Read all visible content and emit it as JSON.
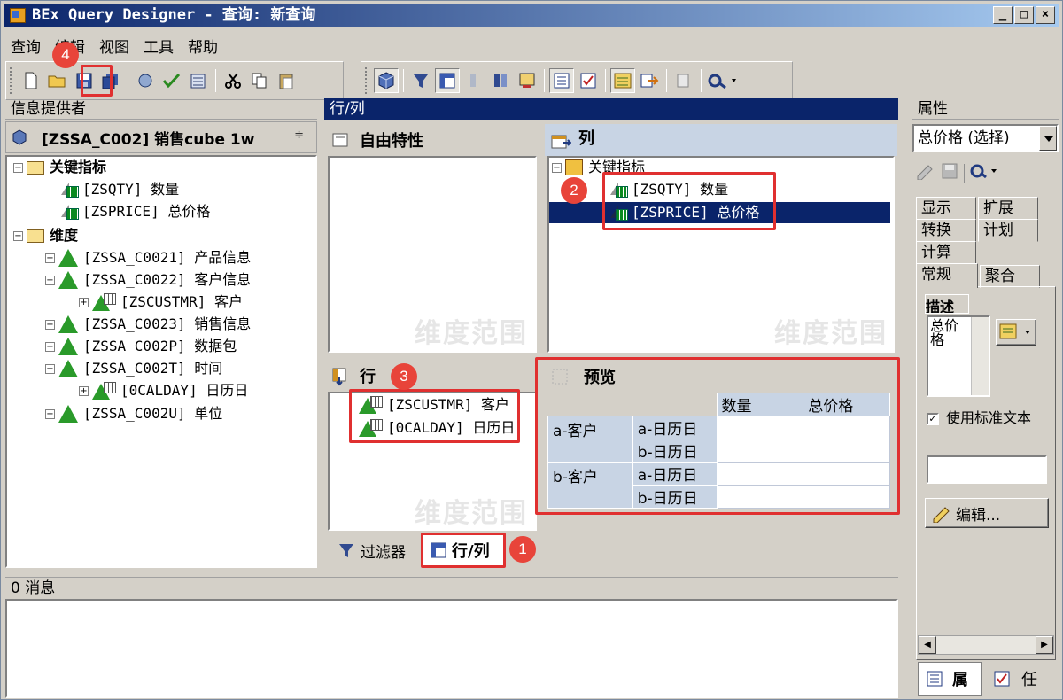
{
  "window": {
    "title": "BEx Query Designer - 查询: 新查询",
    "min": "_",
    "max": "□",
    "close": "×"
  },
  "menu": [
    "查询",
    "编辑",
    "视图",
    "工具",
    "帮助"
  ],
  "toolbar": {
    "icons": [
      "new-icon",
      "open-icon",
      "save-icon",
      "save-all-icon",
      "publish-icon",
      "check-icon",
      "properties-icon",
      "cut-icon",
      "copy-icon",
      "paste-icon",
      "cube-icon",
      "filter-icon",
      "rows-columns-icon",
      "cells-icon",
      "conditions-icon",
      "exceptions-icon",
      "table-view-icon",
      "tasks-icon",
      "key-figures-icon",
      "export-icon",
      "doc-icon",
      "tools-icon"
    ]
  },
  "info_provider": {
    "title": "信息提供者",
    "provider_name": "[ZSSA_C002] 销售cube 1w",
    "tree": [
      {
        "label": "关键指标",
        "type": "folder",
        "expanded": true
      },
      {
        "label": "[ZSQTY] 数量",
        "type": "keyfigure"
      },
      {
        "label": "[ZSPRICE] 总价格",
        "type": "keyfigure"
      },
      {
        "label": "维度",
        "type": "folder",
        "expanded": true
      },
      {
        "label": "[ZSSA_C0021] 产品信息",
        "type": "dimension",
        "collapsed": true
      },
      {
        "label": "[ZSSA_C0022] 客户信息",
        "type": "dimension",
        "expanded": true
      },
      {
        "label": "[ZSCUSTMR] 客户",
        "type": "characteristic"
      },
      {
        "label": "[ZSSA_C0023] 销售信息",
        "type": "dimension",
        "collapsed": true
      },
      {
        "label": "[ZSSA_C002P] 数据包",
        "type": "dimension",
        "collapsed": true
      },
      {
        "label": "[ZSSA_C002T] 时间",
        "type": "dimension",
        "expanded": true
      },
      {
        "label": "[0CALDAY] 日历日",
        "type": "characteristic"
      },
      {
        "label": "[ZSSA_C002U] 单位",
        "type": "dimension",
        "collapsed": true
      }
    ]
  },
  "rows_cols": {
    "title": "行/列",
    "free_chars": {
      "title": "自由特性"
    },
    "columns": {
      "title": "列",
      "root": "关键指标",
      "items": [
        "[ZSQTY] 数量",
        "[ZSPRICE] 总价格"
      ]
    },
    "rows": {
      "title": "行",
      "items": [
        "[ZSCUSTMR] 客户",
        "[0CALDAY] 日历日"
      ]
    },
    "watermark": "维度范围",
    "preview": {
      "title": "预览",
      "headers": [
        "数量",
        "总价格"
      ],
      "groups": [
        {
          "customer": "a-客户",
          "days": [
            "a-日历日",
            "b-日历日"
          ]
        },
        {
          "customer": "b-客户",
          "days": [
            "a-日历日",
            "b-日历日"
          ]
        }
      ]
    },
    "tabs": [
      "过滤器",
      "行/列"
    ]
  },
  "messages": {
    "title": "0 消息"
  },
  "properties": {
    "title": "属性",
    "selected": "总价格 (选择)",
    "tabs_row1": [
      "显示",
      "扩展"
    ],
    "tabs_row2": [
      "转换",
      "计划"
    ],
    "tabs_row3": [
      "计算"
    ],
    "tabs_row4": [
      "常规",
      "聚合"
    ],
    "desc_label": "描述",
    "desc_value": "总价格",
    "use_standard_text": "使用标准文本",
    "edit_button": "编辑...",
    "bottom_tabs": [
      "属",
      "任"
    ]
  },
  "badges": [
    "1",
    "2",
    "3",
    "4"
  ]
}
